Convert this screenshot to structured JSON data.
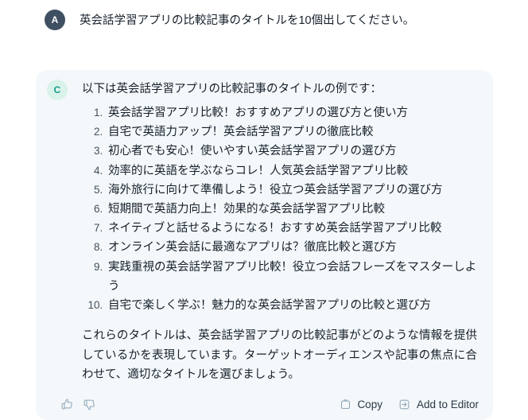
{
  "conversation": {
    "user_message": {
      "avatar_initial": "A",
      "text": "英会話学習アプリの比較記事のタイトルを10個出してください。"
    },
    "assistant_message": {
      "avatar_initial": "C",
      "intro": "以下は英会話学習アプリの比較記事のタイトルの例です：",
      "list_items": [
        "英会話学習アプリ比較！おすすめアプリの選び方と使い方",
        "自宅で英語力アップ！英会話学習アプリの徹底比較",
        "初心者でも安心！使いやすい英会話学習アプリの選び方",
        "効率的に英語を学ぶならコレ！人気英会話学習アプリ比較",
        "海外旅行に向けて準備しよう！役立つ英会話学習アプリの選び方",
        "短期間で英語力向上！効果的な英会話学習アプリ比較",
        "ネイティブと話せるようになる！おすすめ英会話学習アプリ比較",
        "オンライン英会話に最適なアプリは？徹底比較と選び方",
        "実践重視の英会話学習アプリ比較！役立つ会話フレーズをマスターしよう",
        "自宅で楽しく学ぶ！魅力的な英会話学習アプリの比較と選び方"
      ],
      "outro": "これらのタイトルは、英会話学習アプリの比較記事がどのような情報を提供しているかを表現しています。ターゲットオーディエンスや記事の焦点に合わせて、適切なタイトルを選びましょう。"
    },
    "footer": {
      "thumbs_up_icon": "thumbs-up-icon",
      "thumbs_down_icon": "thumbs-down-icon",
      "copy_label": "Copy",
      "copy_icon": "clipboard-icon",
      "add_to_editor_label": "Add to Editor",
      "add_to_editor_icon": "arrow-into-box-icon"
    }
  },
  "colors": {
    "page_background": "#ffffff",
    "card_background": "#f4f8fa",
    "user_avatar_background": "#3e5062",
    "assistant_avatar_background": "#d9f2ea",
    "assistant_avatar_text": "#16a085",
    "body_text": "#16202b",
    "muted_icon": "#9bb0c1"
  }
}
